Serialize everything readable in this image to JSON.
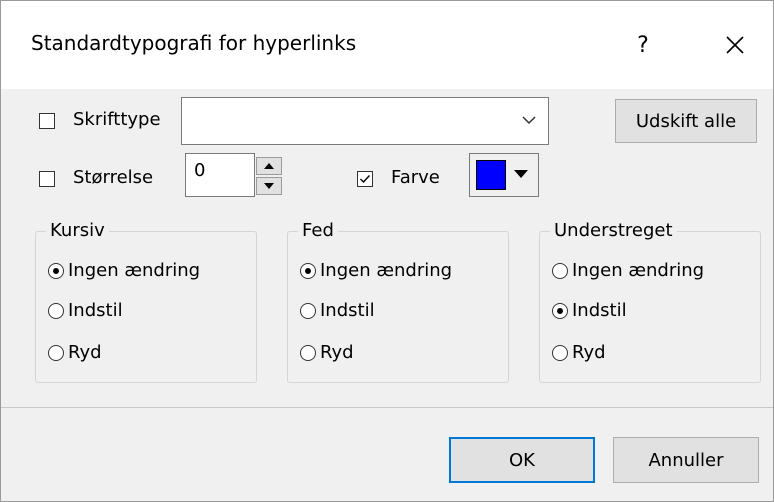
{
  "dialog": {
    "title": "Standardtypografi for hyperlinks",
    "help_label": "?",
    "close_icon": "close-icon"
  },
  "font": {
    "checkbox_label": "Skrifttype",
    "checked": false,
    "combo_value": "",
    "replace_all_label": "Udskift alle"
  },
  "size": {
    "checkbox_label": "Størrelse",
    "checked": false,
    "value": "0"
  },
  "color": {
    "checkbox_label": "Farve",
    "checked": true,
    "value": "#0000ff"
  },
  "groups": {
    "italic": {
      "title": "Kursiv",
      "options": [
        "Ingen ændring",
        "Indstil",
        "Ryd"
      ],
      "selected": 0
    },
    "bold": {
      "title": "Fed",
      "options": [
        "Ingen ændring",
        "Indstil",
        "Ryd"
      ],
      "selected": 0
    },
    "underline": {
      "title": "Understreget",
      "options": [
        "Ingen ændring",
        "Indstil",
        "Ryd"
      ],
      "selected": 1
    }
  },
  "footer": {
    "ok_label": "OK",
    "cancel_label": "Annuller"
  }
}
